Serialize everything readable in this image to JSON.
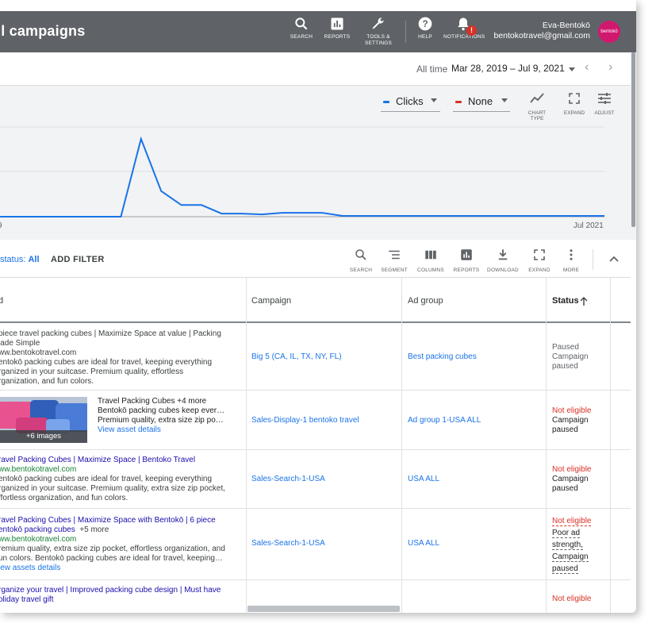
{
  "header": {
    "title": "ll campaigns",
    "buttons": [
      {
        "label": "SEARCH",
        "icon": "search-icon"
      },
      {
        "label": "REPORTS",
        "icon": "reports-icon"
      },
      {
        "label": "TOOLS &",
        "label2": "SETTINGS",
        "icon": "wrench-icon"
      },
      {
        "label": "HELP",
        "icon": "help-icon"
      },
      {
        "label": "NOTIFICATIONS",
        "icon": "bell-icon",
        "badge": "!"
      }
    ],
    "account_name": "Eva-Bentokō",
    "account_email": "bentokotravel@gmail.com",
    "avatar_text": "bentokō",
    "bar_color": "#5f6368"
  },
  "date_range": {
    "label": "All time",
    "value": "Mar 28, 2019 – Jul 9, 2021"
  },
  "chart_controls": {
    "metric1": "Clicks",
    "metric1_color": "#1a73e8",
    "metric2": "None",
    "metric2_color": "#d93025",
    "chart_type": "CHART TYPE",
    "expand": "EXPAND",
    "adjust": "ADJUST"
  },
  "chart_data": {
    "type": "line",
    "x_start_label": "9",
    "x_end_label": "Jul 2021",
    "series": [
      {
        "values": [
          0,
          0,
          0,
          0,
          0,
          0,
          0,
          1.0,
          0.33,
          0.15,
          0.15,
          0.04,
          0.04,
          0.03,
          0.05,
          0.05,
          0.05,
          0.01,
          0.01,
          0.01,
          0.01,
          0.01,
          0.01,
          0.01,
          0.01,
          0.01,
          0.01,
          0.01,
          0.01,
          0.01,
          0.01
        ]
      }
    ],
    "grid": true
  },
  "filter_bar": {
    "status_text": "status: ",
    "status_value": "All",
    "add_filter": "ADD FILTER",
    "tools": [
      "SEARCH",
      "SEGMENT",
      "COLUMNS",
      "REPORTS",
      "DOWNLOAD",
      "EXPAND",
      "MORE"
    ]
  },
  "table": {
    "columns": [
      "d",
      "Campaign",
      "Ad group",
      "Status"
    ],
    "rows": [
      {
        "ad_lines": [
          "piece travel packing cubes | Maximize Space at value | Packing",
          "lade Simple",
          "ww.bentokotravel.com",
          "entokō packing cubes are ideal for travel, keeping everything",
          "rganized in your suitcase. Premium quality, effortless",
          "rganization, and fun colors."
        ],
        "campaign": "Big 5 (CA, IL, TX, NY, FL)",
        "ad_group": "Best packing cubes",
        "status": [
          "Paused",
          "Campaign",
          "paused"
        ]
      },
      {
        "image_caption": "+6 images",
        "ad_lines": [
          "Travel Packing Cubes +4 more",
          "Bentokō packing cubes keep ever…",
          "Premium quality, extra size zip po…",
          "View asset details"
        ],
        "campaign": "Sales-Display-1 bentoko travel",
        "ad_group": "Ad group 1-USA ALL",
        "status": [
          "Not eligible",
          "Campaign",
          "paused"
        ]
      },
      {
        "ad_lines": [
          "ravel Packing Cubes | Maximize Space | Bentoko Travel",
          "ww.bentokotravel.com",
          "entokō packing cubes are ideal for travel, keeping everything",
          "rganized in your suitcase. Premium quality, extra size zip pocket,",
          "ffortless organization, and fun colors."
        ],
        "campaign": "Sales-Search-1-USA",
        "ad_group": "USA ALL",
        "status": [
          "Not eligible",
          "Campaign",
          "paused"
        ]
      },
      {
        "ad_lines": [
          "ravel Packing Cubes | Maximize Space with Bentokō | 6 piece",
          "entokō packing cubes",
          "+5 more",
          "ww.bentokotravel.com",
          "remium quality, extra size zip pocket, effortless organization, and",
          "un colors. Bentokō packing cubes are ideal for travel, keeping…",
          "iew assets details"
        ],
        "campaign": "Sales-Search-1-USA",
        "ad_group": "USA ALL",
        "status": [
          "Not eligible",
          "Poor ad",
          "strength,",
          "Campaign",
          "paused"
        ]
      },
      {
        "ad_lines": [
          "rganize your travel | Improved packing cube design | Must have",
          "oliday travel gift"
        ],
        "status": [
          "Not eligible"
        ]
      }
    ]
  }
}
